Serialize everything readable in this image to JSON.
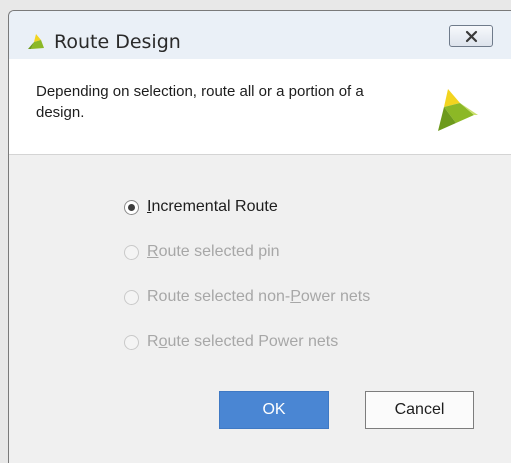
{
  "window": {
    "title": "Route Design",
    "app_icon": "vivado-logo-icon",
    "close_icon": "close-icon"
  },
  "header": {
    "description": "Depending on selection, route all or a portion of a design.",
    "logo_icon": "vivado-logo-icon"
  },
  "options": [
    {
      "label_before": "",
      "mnemonic": "I",
      "label_after": "ncremental Route",
      "selected": true,
      "enabled": true
    },
    {
      "label_before": "",
      "mnemonic": "R",
      "label_after": "oute selected pin",
      "selected": false,
      "enabled": false
    },
    {
      "label_before": "Route selected non-",
      "mnemonic": "P",
      "label_after": "ower nets",
      "selected": false,
      "enabled": false
    },
    {
      "label_before": "R",
      "mnemonic": "o",
      "label_after": "ute selected Power nets",
      "selected": false,
      "enabled": false
    }
  ],
  "buttons": {
    "ok_label": "OK",
    "cancel_label": "Cancel"
  },
  "colors": {
    "ok_button": "#4a86d3",
    "logo_green": "#8cb826",
    "logo_yellow": "#f2d41f"
  }
}
